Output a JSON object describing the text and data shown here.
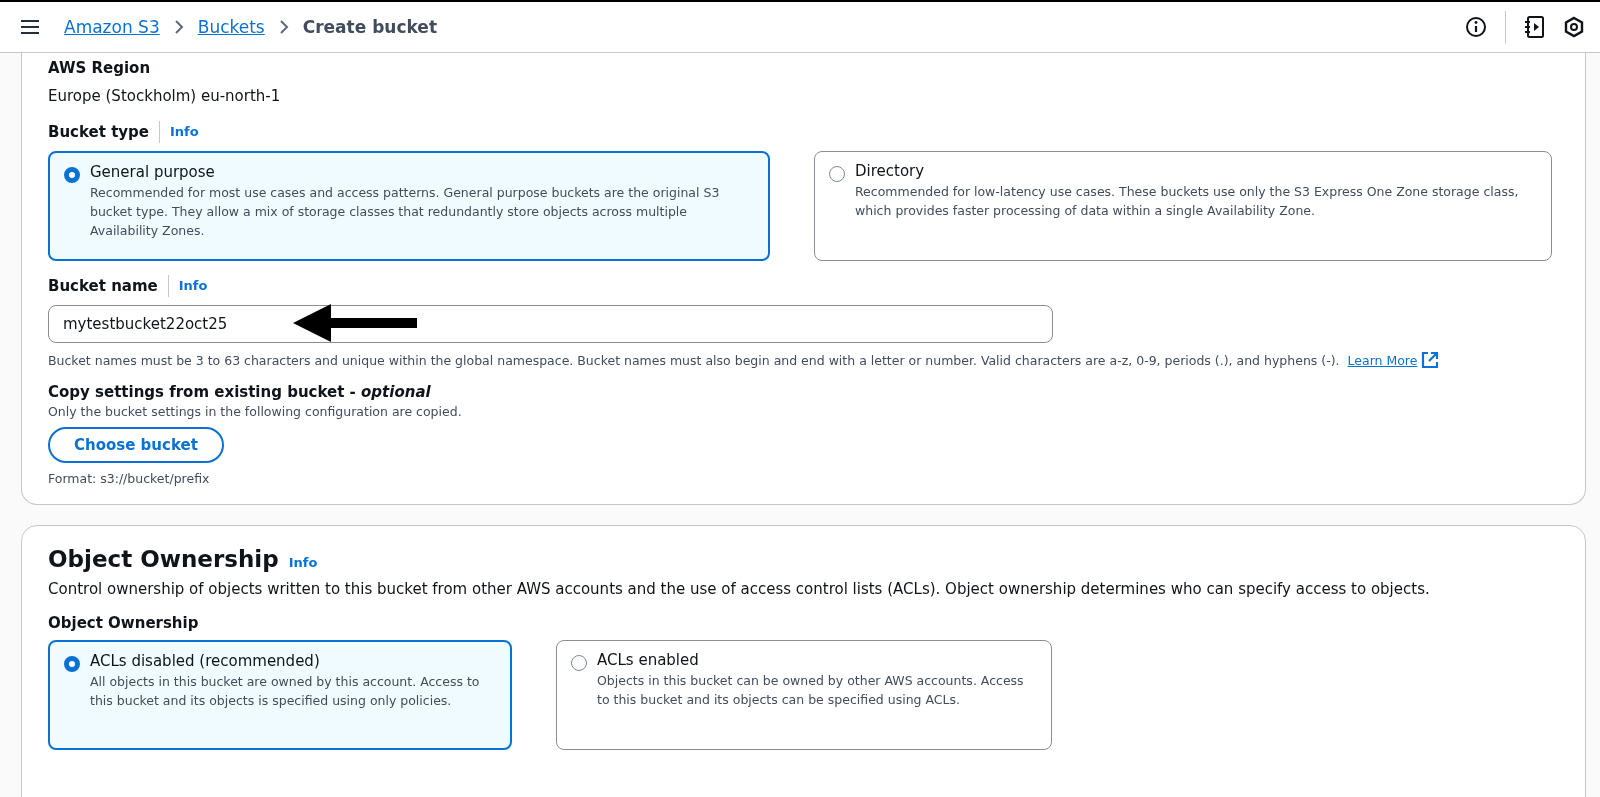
{
  "breadcrumbs": [
    {
      "label": "Amazon S3",
      "kind": "link"
    },
    {
      "label": "Buckets",
      "kind": "link"
    },
    {
      "label": "Create bucket",
      "kind": "current"
    }
  ],
  "general_config": {
    "region": {
      "label": "AWS Region",
      "value": "Europe (Stockholm) eu-north-1"
    },
    "bucket_type": {
      "label": "Bucket type",
      "info": "Info",
      "options": [
        {
          "title": "General purpose",
          "description": "Recommended for most use cases and access patterns. General purpose buckets are the original S3 bucket type. They allow a mix of storage classes that redundantly store objects across multiple Availability Zones.",
          "selected": true
        },
        {
          "title": "Directory",
          "description": "Recommended for low-latency use cases. These buckets use only the S3 Express One Zone storage class, which provides faster processing of data within a single Availability Zone.",
          "selected": false
        }
      ]
    },
    "bucket_name": {
      "label": "Bucket name",
      "info": "Info",
      "value": "mytestbucket22oct25",
      "hint": "Bucket names must be 3 to 63 characters and unique within the global namespace. Bucket names must also begin and end with a letter or number. Valid characters are a-z, 0-9, periods (.), and hyphens (-).",
      "link": "Learn More"
    },
    "copy_settings": {
      "label": "Copy settings from existing bucket - *optional*",
      "description": "Only the bucket settings in the following configuration are copied.",
      "button": "Choose bucket",
      "format": "Format: s3://bucket/prefix"
    }
  },
  "object_ownership": {
    "title": "Object Ownership",
    "info": "Info",
    "description": "Control ownership of objects written to this bucket from other AWS accounts and the use of access control lists (ACLs). Object ownership determines who can specify access to objects.",
    "label": "Object Ownership",
    "options": [
      {
        "title": "ACLs disabled (recommended)",
        "description": "All objects in this bucket are owned by this account. Access to this bucket and its objects is specified using only policies.",
        "selected": true
      },
      {
        "title": "ACLs enabled",
        "description": "Objects in this bucket can be owned by other AWS accounts. Access to this bucket and its objects can be specified using ACLs.",
        "selected": false
      }
    ]
  }
}
